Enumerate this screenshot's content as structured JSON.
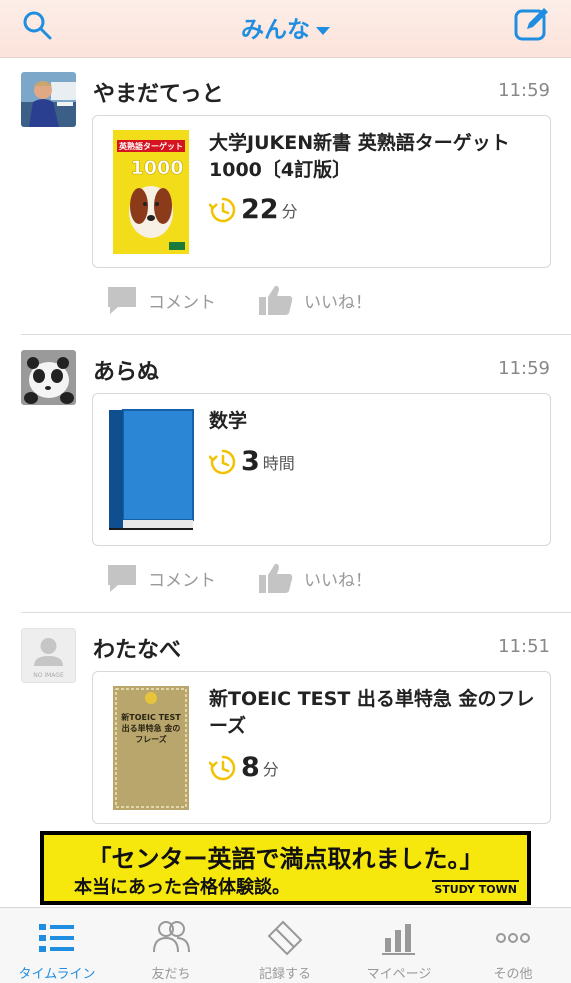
{
  "header": {
    "title": "みんな"
  },
  "posts": [
    {
      "user": "やまだてっと",
      "time": "11:59",
      "book_title": "大学JUKEN新書 英熟語ターゲット1000〔4訂版〕",
      "duration_value": "22",
      "duration_unit": "分",
      "cover_text": "英熟語ターゲット",
      "cover_number": "1000"
    },
    {
      "user": "あらぬ",
      "time": "11:59",
      "book_title": "数学",
      "duration_value": "3",
      "duration_unit": "時間"
    },
    {
      "user": "わたなべ",
      "time": "11:51",
      "book_title": "新TOEIC TEST 出る単特急 金のフレーズ",
      "duration_value": "8",
      "duration_unit": "分",
      "avatar_text": "NO IMAGE",
      "cover_text": "新TOEIC TEST 出る単特急 金のフレーズ"
    }
  ],
  "actions": {
    "comment": "コメント",
    "like": "いいね！"
  },
  "banner": {
    "line1": "「センター英語で満点取れました。」",
    "line2": "本当にあった合格体験談。",
    "logo": "STUDY TOWN"
  },
  "tabs": [
    {
      "label": "タイムライン",
      "icon": "list-icon",
      "active": true
    },
    {
      "label": "友だち",
      "icon": "friends-icon"
    },
    {
      "label": "記録する",
      "icon": "eraser-icon"
    },
    {
      "label": "マイページ",
      "icon": "bar-chart-icon"
    },
    {
      "label": "その他",
      "icon": "more-icon"
    }
  ],
  "colors": {
    "accent": "#1f8ee0",
    "clock": "#f2c200",
    "banner": "#f6e80d"
  }
}
